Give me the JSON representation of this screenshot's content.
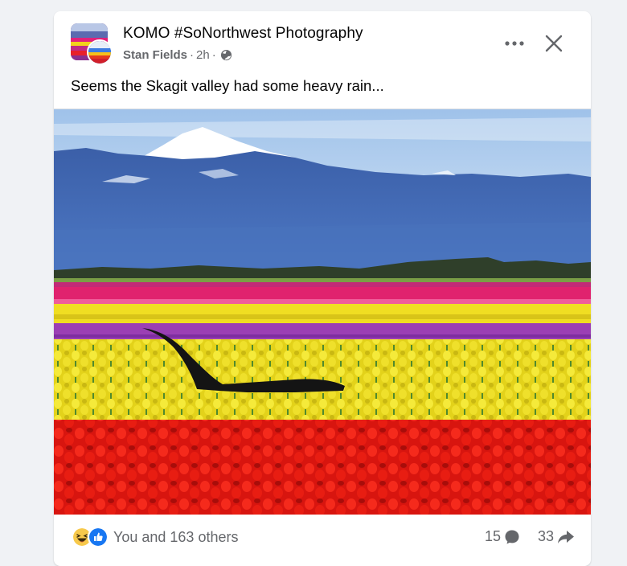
{
  "post": {
    "group_name": "KOMO #SoNorthwest Photography",
    "author": "Stan Fields",
    "separator": "·",
    "time": "2h",
    "privacy_icon": "globe-icon",
    "caption": "Seems the Skagit valley had some heavy rain...",
    "photo_alt": "Orca fin in tulip field",
    "more_icon": "more-options-icon",
    "close_icon": "close-icon"
  },
  "footer": {
    "reaction_icons": [
      "haha-emoji-icon",
      "like-icon"
    ],
    "reaction_text": "You and 163 others",
    "comments_count": "15",
    "comments_icon": "comment-icon",
    "shares_count": "33",
    "shares_icon": "share-icon"
  },
  "colors": {
    "card_bg": "#ffffff",
    "page_bg": "#f0f2f5",
    "primary_text": "#050505",
    "secondary_text": "#65676b",
    "like_blue": "#1877f2"
  }
}
